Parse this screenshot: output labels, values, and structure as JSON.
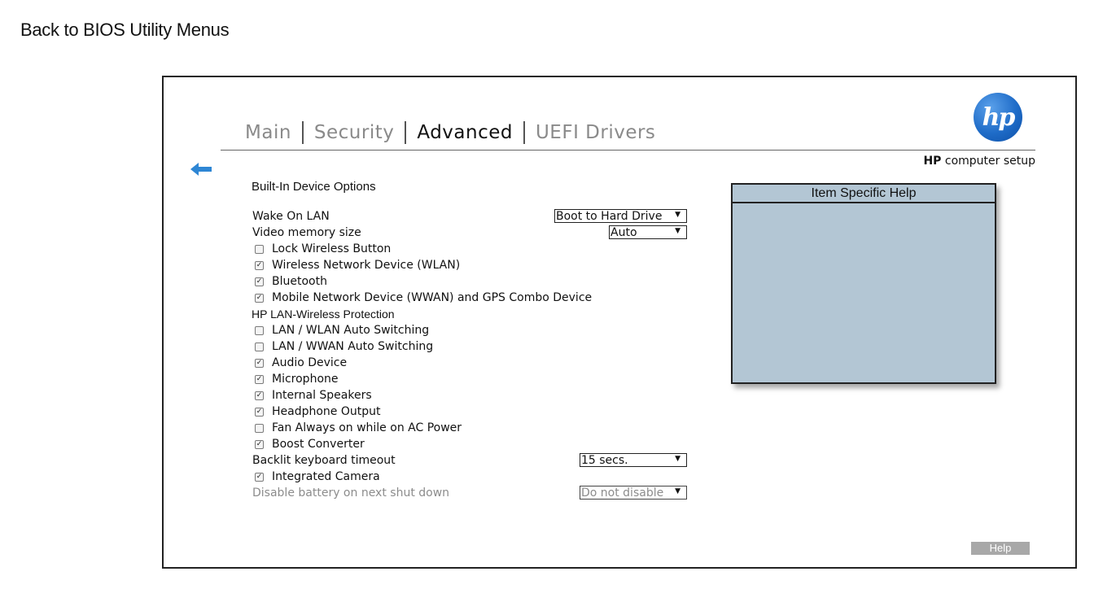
{
  "top_link": {
    "label": "Back to BIOS Utility Menus"
  },
  "tabs": [
    {
      "label": "Main",
      "active": false
    },
    {
      "label": "Security",
      "active": false
    },
    {
      "label": "Advanced",
      "active": true
    },
    {
      "label": "UEFI Drivers",
      "active": false
    }
  ],
  "brand": {
    "logo_text": "hp",
    "title_bold": "HP",
    "title_rest": "computer setup",
    "logo_color": "#1f6cc8"
  },
  "icons": {
    "back": "left-arrow-icon",
    "logo": "hp-logo-icon"
  },
  "colors": {
    "back_arrow": "#2e86d4",
    "help_panel_bg": "#b3c6d4",
    "help_button_bg": "#a8a8a8",
    "disabled_text": "#8c8c8c"
  },
  "section": {
    "title": "Built-In Device Options"
  },
  "settings": [
    {
      "type": "select",
      "label": "Wake On LAN",
      "value": "Boot to Hard Drive"
    },
    {
      "type": "select",
      "label": "Video memory size",
      "value": "Auto"
    },
    {
      "type": "checkbox",
      "label": "Lock Wireless Button",
      "checked": false
    },
    {
      "type": "checkbox",
      "label": "Wireless Network Device (WLAN)",
      "checked": true
    },
    {
      "type": "checkbox",
      "label": "Bluetooth",
      "checked": true
    },
    {
      "type": "checkbox",
      "label": "Mobile Network Device (WWAN) and GPS Combo Device",
      "checked": true
    },
    {
      "type": "group",
      "label": "HP LAN-Wireless Protection"
    },
    {
      "type": "checkbox",
      "label": "LAN / WLAN Auto Switching",
      "checked": false
    },
    {
      "type": "checkbox",
      "label": "LAN / WWAN Auto Switching",
      "checked": false
    },
    {
      "type": "checkbox",
      "label": "Audio Device",
      "checked": true
    },
    {
      "type": "checkbox",
      "label": "Microphone",
      "checked": true
    },
    {
      "type": "checkbox",
      "label": "Internal Speakers",
      "checked": true
    },
    {
      "type": "checkbox",
      "label": "Headphone Output",
      "checked": true
    },
    {
      "type": "checkbox",
      "label": "Fan Always on while on AC Power",
      "checked": false
    },
    {
      "type": "checkbox",
      "label": "Boost Converter",
      "checked": true
    },
    {
      "type": "select",
      "label": "Backlit keyboard timeout",
      "value": "15 secs."
    },
    {
      "type": "checkbox",
      "label": "Integrated Camera",
      "checked": true
    },
    {
      "type": "select",
      "label": "Disable battery on next shut down",
      "value": "Do not disable",
      "disabled": true
    }
  ],
  "help_panel": {
    "title": "Item Specific Help"
  },
  "help_button": {
    "label": "Help"
  }
}
